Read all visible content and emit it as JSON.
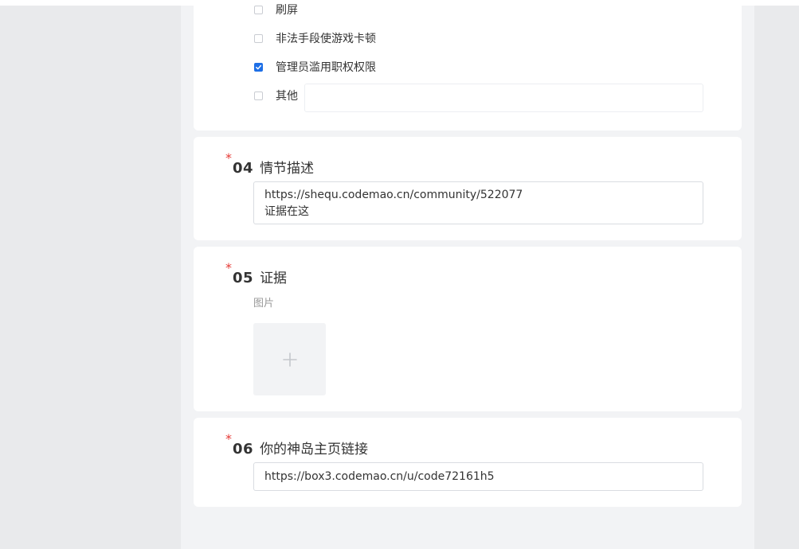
{
  "q03": {
    "options": [
      {
        "label": "刷屏",
        "checked": false
      },
      {
        "label": "非法手段使游戏卡顿",
        "checked": false
      },
      {
        "label": "管理员滥用职权权限",
        "checked": true
      },
      {
        "label": "其他",
        "checked": false
      }
    ],
    "other_value": ""
  },
  "q04": {
    "required_mark": "*",
    "number": "04",
    "title": "情节描述",
    "value_line1": "https://shequ.codemao.cn/community/522077",
    "value_line2": "证据在这"
  },
  "q05": {
    "required_mark": "*",
    "number": "05",
    "title": "证据",
    "sub_label": "图片",
    "upload_icon": "plus-icon"
  },
  "q06": {
    "required_mark": "*",
    "number": "06",
    "title": "你的神岛主页链接",
    "value": "https://box3.codemao.cn/u/code72161h5"
  },
  "colors": {
    "accent": "#1e6fe6",
    "required": "#e53935",
    "page_bg": "#f2f3f5",
    "side_bg": "#e9eaec"
  }
}
